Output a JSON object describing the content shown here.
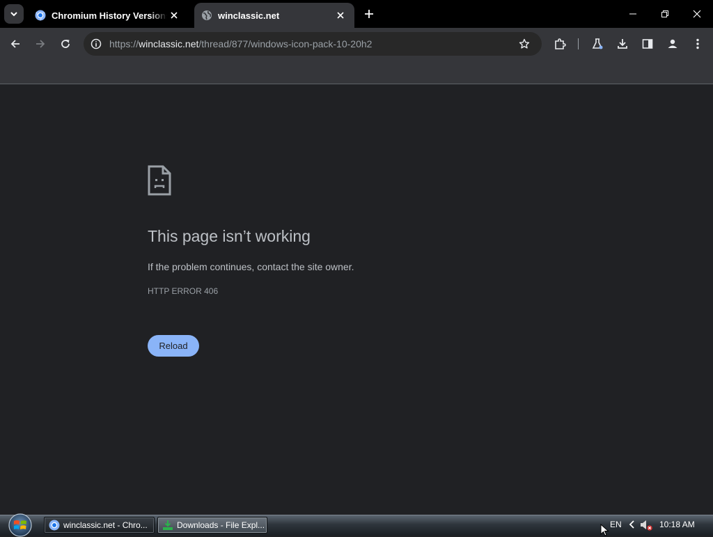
{
  "tabs": [
    {
      "title": "Chromium History Versions Download",
      "active": false,
      "favicon": "chromium-icon"
    },
    {
      "title": "winclassic.net",
      "active": true,
      "favicon": "globe-icon"
    }
  ],
  "address_bar": {
    "scheme": "https://",
    "host": "winclassic.net",
    "path": "/thread/877/windows-icon-pack-10-20h2"
  },
  "error_page": {
    "icon": "sad-page-icon",
    "title": "This page isn’t working",
    "message": "If the problem continues, contact the site owner.",
    "code": "HTTP ERROR 406",
    "reload_label": "Reload"
  },
  "taskbar": {
    "buttons": [
      {
        "label": "winclassic.net - Chro...",
        "icon": "chromium-icon"
      },
      {
        "label": "Downloads - File Expl...",
        "icon": "downloads-folder-icon"
      }
    ],
    "language": "EN",
    "time": "10:18 AM"
  },
  "colors": {
    "tab_strip": "#000000",
    "toolbar": "#35363a",
    "page_background": "#202124",
    "accent_button": "#8ab4f8",
    "title_text": "#bdc1c6"
  }
}
